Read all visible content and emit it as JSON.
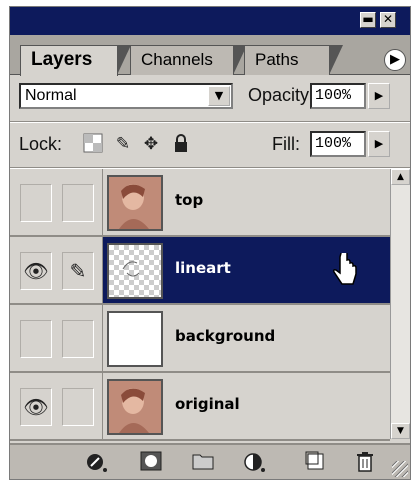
{
  "tabs": [
    {
      "label": "Layers",
      "active": true
    },
    {
      "label": "Channels",
      "active": false
    },
    {
      "label": "Paths",
      "active": false
    }
  ],
  "blend_mode": {
    "value": "Normal"
  },
  "opacity": {
    "label": "Opacity:",
    "value": "100%"
  },
  "lock": {
    "label": "Lock:",
    "icons": [
      "transparency-lock-icon",
      "brush-lock-icon",
      "move-lock-icon",
      "padlock-icon"
    ]
  },
  "fill": {
    "label": "Fill:",
    "value": "100%"
  },
  "layers": [
    {
      "name": "top",
      "visible": false,
      "linked": false,
      "thumb": "portrait",
      "selected": false
    },
    {
      "name": "lineart",
      "visible": true,
      "linked": true,
      "thumb": "transparent-sketch",
      "selected": true
    },
    {
      "name": "background",
      "visible": false,
      "linked": false,
      "thumb": "white",
      "selected": false
    },
    {
      "name": "original",
      "visible": true,
      "linked": false,
      "thumb": "portrait",
      "selected": false
    }
  ],
  "bottom_icons": [
    "layer-style-icon",
    "mask-icon",
    "new-set-icon",
    "adjustment-layer-icon",
    "new-layer-icon",
    "trash-icon"
  ],
  "colors": {
    "title_bar": "#0d1a5c",
    "selection": "#0d1a5c",
    "panel": "#d6d3ce"
  }
}
